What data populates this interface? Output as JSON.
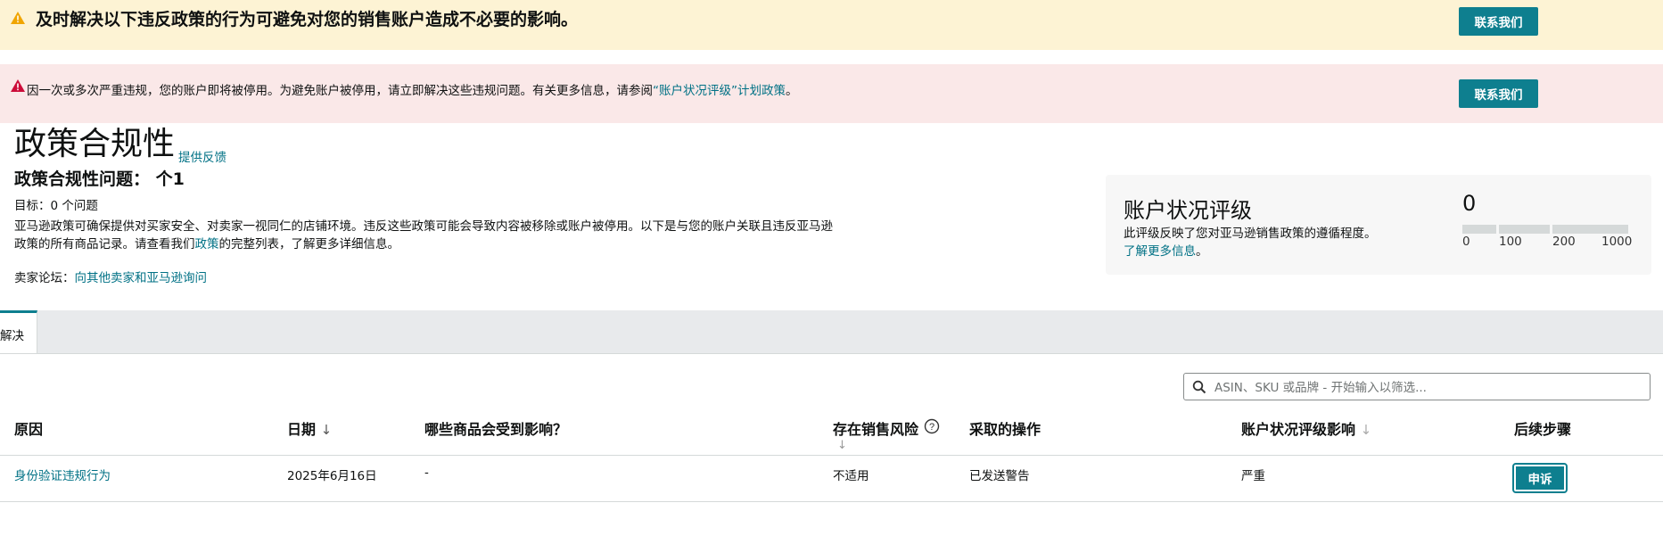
{
  "warning_banner": {
    "title": "及时解决以下违反政策的行为可避免对您的销售账户造成不必要的影响。",
    "contact_button": "联系我们",
    "icon": "warning-triangle-icon",
    "color": "#fdf3d4"
  },
  "error_banner": {
    "text_before": "因一次或多次严重违规，您的账户即将被停用。为避免账户被停用，请立即解决这些违规问题。有关更多信息，请参阅",
    "link": "“账户状况评级”计划政策",
    "text_after": "。",
    "contact_button": "联系我们",
    "icon": "alert-triangle-icon",
    "color": "#fae8e8"
  },
  "page": {
    "title": "政策合规性",
    "feedback_link": "提供反馈",
    "issues_title": "政策合规性问题： 个1",
    "target": "目标：0 个问题",
    "desc_before": "亚马逊政策可确保提供对买家安全、对卖家一视同仁的店铺环境。违反这些政策可能会导致内容被移除或账户被停用。以下是与您的账户关联且违反亚马逊政策的所有商品记录。请查看我们",
    "desc_link": "政策",
    "desc_after": "的完整列表，了解更多详细信息。",
    "forum_label": "卖家论坛：",
    "forum_link": "向其他卖家和亚马逊询问"
  },
  "account_health": {
    "title": "账户状况评级",
    "desc": "此评级反映了您对亚马逊销售政策的遵循程度。",
    "learn_more": "了解更多信息",
    "learn_more_after": "。",
    "score": "0",
    "scale_labels": [
      "0",
      "100",
      "200",
      "1000"
    ]
  },
  "tabs": [
    {
      "label": "解决",
      "active": true
    }
  ],
  "search": {
    "placeholder": "ASIN、SKU 或品牌 - 开始输入以筛选...",
    "value": ""
  },
  "table": {
    "headers": {
      "reason": "原因",
      "date": "日期",
      "date_sort": "↓",
      "affected": "哪些商品会受到影响？",
      "risk": "存在销售风险",
      "risk_sort": "↓",
      "action": "采取的操作",
      "impact": "账户状况评级影响",
      "impact_sort": "↓",
      "next_steps": "后续步骤"
    },
    "rows": [
      {
        "reason": "身份验证违规行为",
        "date": "2025年6月16日",
        "affected": "-",
        "risk": "不适用",
        "action": "已发送警告",
        "impact": "严重",
        "next_step_button": "申诉"
      }
    ]
  },
  "colors": {
    "accent": "#0e7f8f",
    "link": "#007185",
    "warning_icon": "#f0a500",
    "error_icon": "#cc0c39"
  }
}
